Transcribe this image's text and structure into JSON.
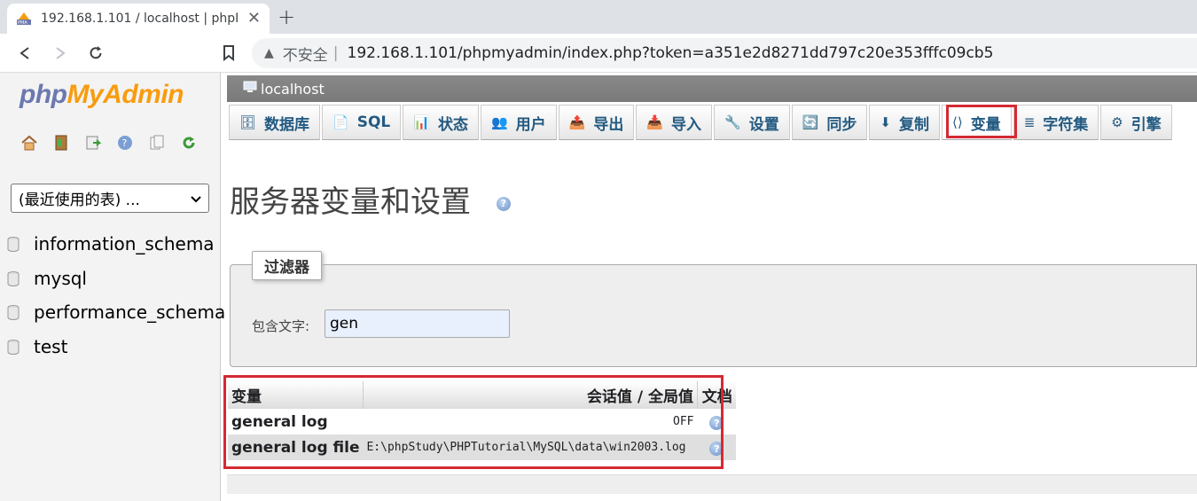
{
  "browser": {
    "tab_title": "192.168.1.101 / localhost | phpMyAdmin",
    "new_tab": "+",
    "close": "✕",
    "insecure_label": "不安全",
    "url": "192.168.1.101/phpmyadmin/index.php?token=a351e2d8271dd797c20e353fffc09cb5"
  },
  "sidebar": {
    "logo_php": "php",
    "logo_myadmin": "MyAdmin",
    "recent_tables_select": "(最近使用的表) ...",
    "databases": [
      {
        "label": "information_schema"
      },
      {
        "label": "mysql"
      },
      {
        "label": "performance_schema"
      },
      {
        "label": "test"
      }
    ]
  },
  "server_bar": {
    "label": "localhost"
  },
  "menu": {
    "items": [
      {
        "label": "数据库",
        "icon": "database-icon"
      },
      {
        "label": "SQL",
        "icon": "sql-icon"
      },
      {
        "label": "状态",
        "icon": "status-icon"
      },
      {
        "label": "用户",
        "icon": "users-icon"
      },
      {
        "label": "导出",
        "icon": "export-icon"
      },
      {
        "label": "导入",
        "icon": "import-icon"
      },
      {
        "label": "设置",
        "icon": "settings-icon"
      },
      {
        "label": "同步",
        "icon": "sync-icon"
      },
      {
        "label": "复制",
        "icon": "replication-icon"
      },
      {
        "label": "变量",
        "icon": "variables-icon"
      },
      {
        "label": "字符集",
        "icon": "charset-icon"
      },
      {
        "label": "引擎",
        "icon": "engine-icon"
      }
    ],
    "active_index": 9
  },
  "page": {
    "title": "服务器变量和设置",
    "help": "?"
  },
  "filter": {
    "legend": "过滤器",
    "label": "包含文字:",
    "value": "gen"
  },
  "table": {
    "headers": {
      "variable": "变量",
      "value": "会话值 / 全局值",
      "doc": "文档"
    },
    "rows": [
      {
        "name": "general log",
        "value": "OFF"
      },
      {
        "name": "general log file",
        "value": "E:\\phpStudy\\PHPTutorial\\MySQL\\data\\win2003.log"
      }
    ]
  },
  "colors": {
    "highlight": "#d42a33",
    "menu_text": "#235a81",
    "logo_php": "#6c78af",
    "logo_myadmin": "#f89c0e"
  }
}
